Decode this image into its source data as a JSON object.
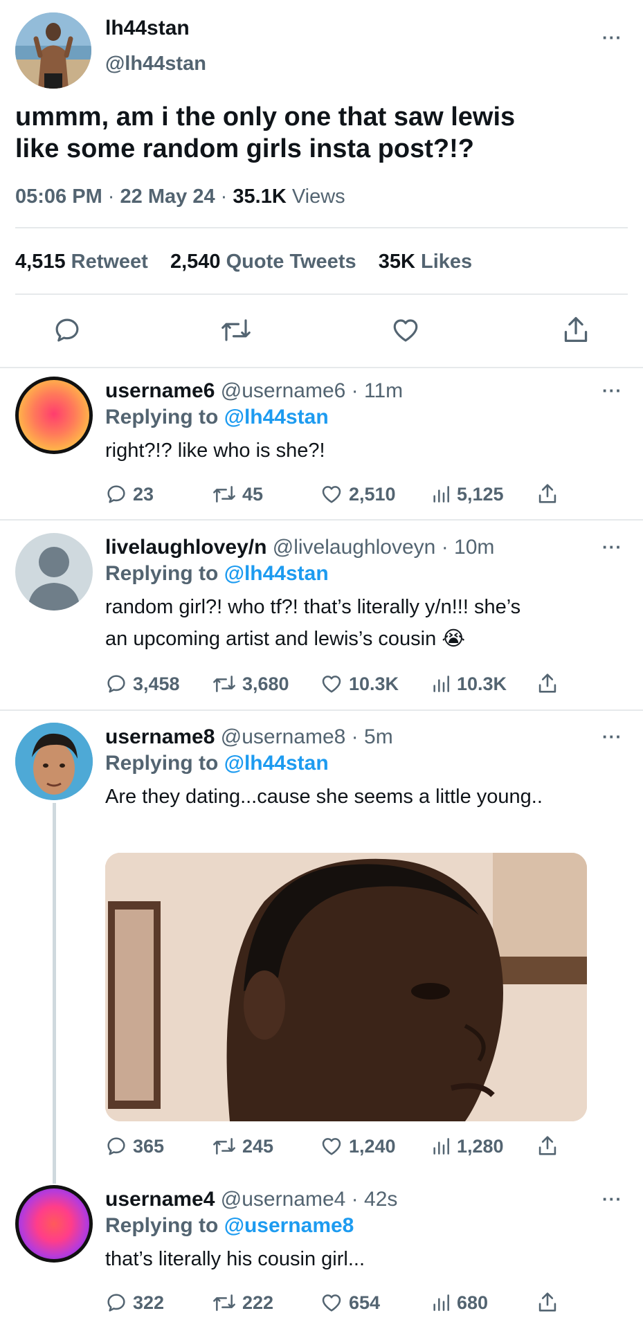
{
  "main_tweet": {
    "display_name": "lh44stan",
    "handle": "@lh44stan",
    "text_line1": "ummm, am i the only one that saw lewis",
    "text_line2": "like some random girls insta post?!?",
    "time": "05:06 PM",
    "date": "22 May 24",
    "views_count": "35.1K",
    "views_label": "Views",
    "retweets_count": "4,515",
    "retweets_label": "Retweet",
    "quotes_count": "2,540",
    "quotes_label": "Quote Tweets",
    "likes_count": "35K",
    "likes_label": "Likes",
    "more": "···"
  },
  "replies": [
    {
      "display_name": "username6",
      "handle": "@username6",
      "age": "11m",
      "replying_prefix": "Replying to",
      "replying_to": "@lh44stan",
      "text_lines": [
        "right?!? like who is she?!"
      ],
      "replies": "23",
      "retweets": "45",
      "likes": "2,510",
      "views": "5,125"
    },
    {
      "display_name": "livelaughlovey/n",
      "handle": "@livelaughloveyn",
      "age": "10m",
      "replying_prefix": "Replying to",
      "replying_to": "@lh44stan",
      "text_lines": [
        "random girl?! who tf?! that’s literally y/n!!! she’s",
        "an upcoming artist and lewis’s cousin 😭"
      ],
      "replies": "3,458",
      "retweets": "3,680",
      "likes": "10.3K",
      "views": "10.3K"
    },
    {
      "display_name": "username8",
      "handle": "@username8",
      "age": "5m",
      "replying_prefix": "Replying to",
      "replying_to": "@lh44stan",
      "text_lines": [
        "Are they dating...cause she seems a little young.."
      ],
      "replies": "365",
      "retweets": "245",
      "likes": "1,240",
      "views": "1,280"
    },
    {
      "display_name": "username4",
      "handle": "@username4",
      "age": "42s",
      "replying_prefix": "Replying to",
      "replying_to": "@username8",
      "text_lines": [
        "that’s literally his cousin girl..."
      ],
      "replies": "322",
      "retweets": "222",
      "likes": "654",
      "views": "680"
    }
  ],
  "separator": "·",
  "colors": {
    "link_blue": "#1d9bf0",
    "text_grey": "#536471",
    "text_dark": "#0f1419",
    "divider": "#e6e9eb"
  },
  "icons": [
    "reply-icon",
    "retweet-icon",
    "like-icon",
    "share-icon",
    "views-icon",
    "more-icon"
  ]
}
